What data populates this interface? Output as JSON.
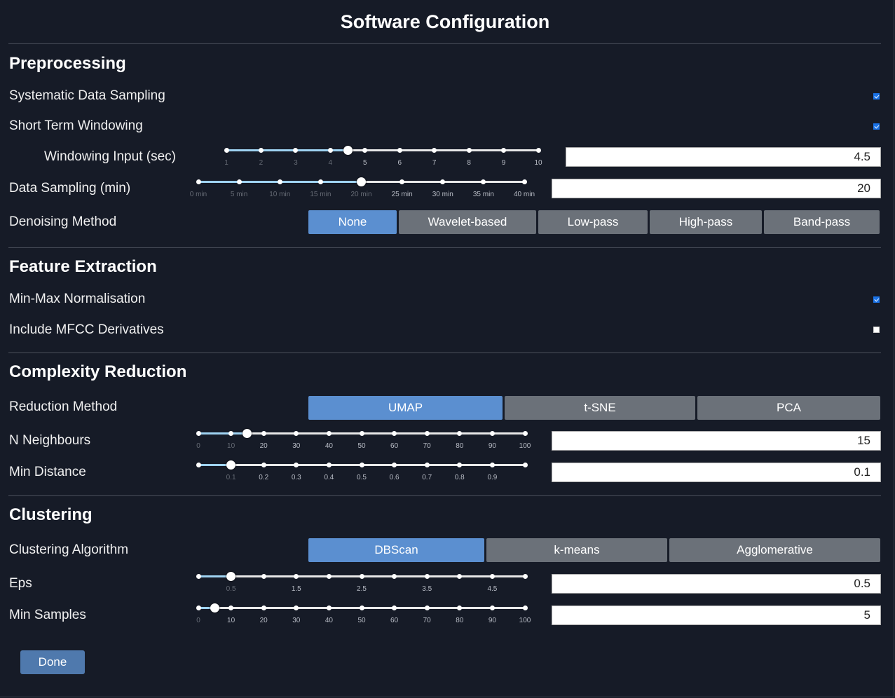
{
  "title": "Software Configuration",
  "preprocessing": {
    "heading": "Preprocessing",
    "systematic_sampling": {
      "label": "Systematic Data Sampling",
      "checked": true
    },
    "short_term_windowing": {
      "label": "Short Term Windowing",
      "checked": true
    },
    "windowing_input": {
      "label": "Windowing Input (sec)",
      "value": "4.5",
      "ticks": [
        "1",
        "2",
        "3",
        "4",
        "5",
        "6",
        "7",
        "8",
        "9",
        "10"
      ],
      "ticks_highlighted": [
        false,
        false,
        false,
        false,
        true,
        true,
        true,
        true,
        true,
        true
      ],
      "min": 1,
      "max": 10,
      "current": 4.5
    },
    "data_sampling": {
      "label": "Data Sampling (min)",
      "value": "20",
      "ticks": [
        "0 min",
        "5 min",
        "10 min",
        "15 min",
        "20 min",
        "25 min",
        "30 min",
        "35 min",
        "40 min"
      ],
      "ticks_highlighted": [
        false,
        false,
        false,
        false,
        false,
        true,
        true,
        true,
        true
      ],
      "min": 0,
      "max": 40,
      "current": 20
    },
    "denoising": {
      "label": "Denoising Method",
      "options": [
        "None",
        "Wavelet-based",
        "Low-pass",
        "High-pass",
        "Band-pass"
      ],
      "selected": "None"
    }
  },
  "feature_extraction": {
    "heading": "Feature Extraction",
    "min_max": {
      "label": "Min-Max Normalisation",
      "checked": true
    },
    "mfcc_derivatives": {
      "label": "Include MFCC Derivatives",
      "checked": false
    }
  },
  "complexity_reduction": {
    "heading": "Complexity Reduction",
    "method": {
      "label": "Reduction Method",
      "options": [
        "UMAP",
        "t-SNE",
        "PCA"
      ],
      "selected": "UMAP"
    },
    "n_neighbours": {
      "label": "N Neighbours",
      "value": "15",
      "ticks": [
        "0",
        "10",
        "20",
        "30",
        "40",
        "50",
        "60",
        "70",
        "80",
        "90",
        "100"
      ],
      "ticks_highlighted": [
        false,
        false,
        true,
        true,
        true,
        true,
        true,
        true,
        true,
        true,
        true
      ],
      "min": 0,
      "max": 100,
      "current": 15
    },
    "min_distance": {
      "label": "Min Distance",
      "value": "0.1",
      "ticks": [
        "",
        "0.1",
        "0.2",
        "0.3",
        "0.4",
        "0.5",
        "0.6",
        "0.7",
        "0.8",
        "0.9",
        ""
      ],
      "ticks_highlighted": [
        false,
        false,
        true,
        true,
        true,
        true,
        true,
        true,
        true,
        true,
        false
      ],
      "min": 0,
      "max": 1,
      "current": 0.1
    }
  },
  "clustering": {
    "heading": "Clustering",
    "algorithm": {
      "label": "Clustering Algorithm",
      "options": [
        "DBScan",
        "k-means",
        "Agglomerative"
      ],
      "selected": "DBScan"
    },
    "eps": {
      "label": "Eps",
      "value": "0.5",
      "ticks": [
        "",
        "0.5",
        "",
        "1.5",
        "",
        "2.5",
        "",
        "3.5",
        "",
        "4.5",
        ""
      ],
      "ticks_highlighted": [
        false,
        false,
        false,
        true,
        false,
        true,
        false,
        true,
        false,
        true,
        false
      ],
      "min": 0,
      "max": 5,
      "current": 0.5
    },
    "min_samples": {
      "label": "Min Samples",
      "value": "5",
      "ticks": [
        "0",
        "10",
        "20",
        "30",
        "40",
        "50",
        "60",
        "70",
        "80",
        "90",
        "100"
      ],
      "ticks_highlighted": [
        false,
        true,
        true,
        true,
        true,
        true,
        true,
        true,
        true,
        true,
        true
      ],
      "min": 0,
      "max": 100,
      "current": 5
    }
  },
  "done_label": "Done"
}
